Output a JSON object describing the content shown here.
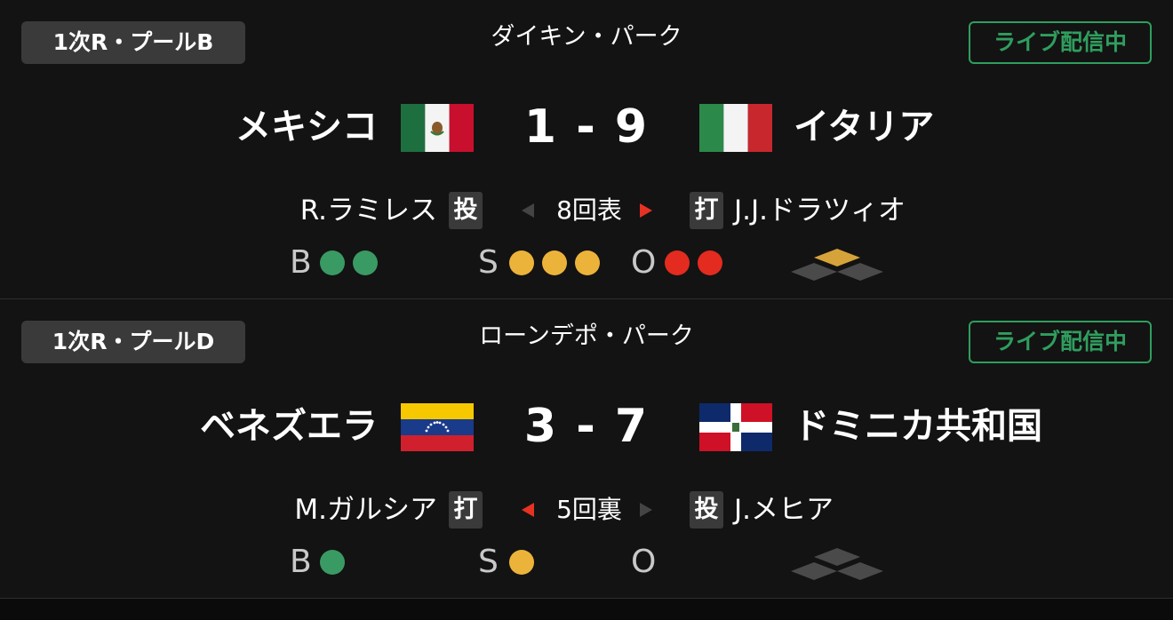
{
  "games": [
    {
      "pool": "1次R・プールB",
      "venue": "ダイキン・パーク",
      "live": "ライブ配信中",
      "home_team": "メキシコ",
      "away_team": "イタリア",
      "score": "1 - 9",
      "left_player": "R.ラミレス",
      "left_role": "投",
      "inning": "8回表",
      "right_role": "打",
      "right_player": "J.J.ドラツィオ",
      "active_arrow": "right",
      "balls_label": "B",
      "strikes_label": "S",
      "outs_label": "O",
      "balls": 2,
      "strikes": 3,
      "outs": 2,
      "bases": {
        "first": false,
        "second": true,
        "third": false
      },
      "home_flag": "mexico-flag",
      "away_flag": "italy-flag"
    },
    {
      "pool": "1次R・プールD",
      "venue": "ローンデポ・パーク",
      "live": "ライブ配信中",
      "home_team": "ベネズエラ",
      "away_team": "ドミニカ共和国",
      "score": "3 - 7",
      "left_player": "M.ガルシア",
      "left_role": "打",
      "inning": "5回裏",
      "right_role": "投",
      "right_player": "J.メヒア",
      "active_arrow": "left",
      "balls_label": "B",
      "strikes_label": "S",
      "outs_label": "O",
      "balls": 1,
      "strikes": 1,
      "outs": 0,
      "bases": {
        "first": false,
        "second": false,
        "third": false
      },
      "home_flag": "venezuela-flag",
      "away_flag": "dominican-republic-flag"
    }
  ],
  "colors": {
    "live": "#2f9e5e",
    "ball": "#3a9a63",
    "strike": "#ecb33a",
    "out": "#e32b1f",
    "arrow_active": "#e63222",
    "base_occupied": "#d6a33a",
    "base_empty": "#4a4a4a"
  }
}
